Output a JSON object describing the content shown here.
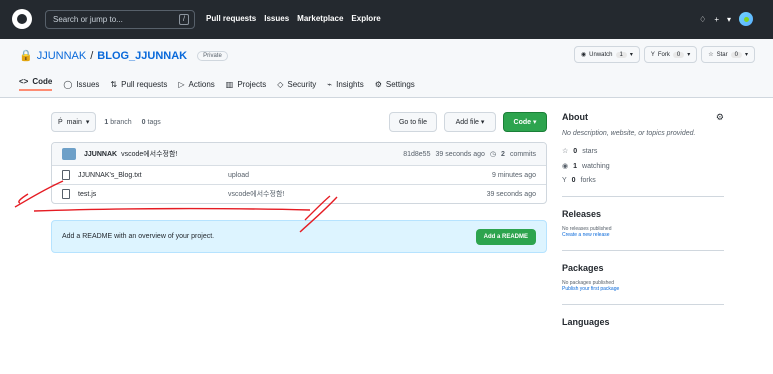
{
  "header": {
    "search_placeholder": "Search or jump to...",
    "slash_key": "/",
    "nav": [
      "Pull requests",
      "Issues",
      "Marketplace",
      "Explore"
    ],
    "plus": "+",
    "chevron": "▾"
  },
  "repo": {
    "owner": "JJUNNAK",
    "separator": "/",
    "name": "BLOG_JJUNNAK",
    "visibility": "Private",
    "unwatch": "Unwatch",
    "watch_count": "1",
    "fork": "Fork",
    "fork_count": "0",
    "star": "Star",
    "star_count": "0"
  },
  "tabs": [
    "Code",
    "Issues",
    "Pull requests",
    "Actions",
    "Projects",
    "Security",
    "Insights",
    "Settings"
  ],
  "toolbar": {
    "branch": "main",
    "branches": "1",
    "branches_label": "branch",
    "tags": "0",
    "tags_label": "tags",
    "go_to_file": "Go to file",
    "add_file": "Add file",
    "code": "Code"
  },
  "commit": {
    "author": "JJUNNAK",
    "message": "vscode에서수정함!",
    "hash": "81d8e55",
    "time": "39 seconds ago",
    "commits": "2",
    "commits_label": "commits"
  },
  "files": [
    {
      "name": "JJUNNAK's_Blog.txt",
      "message": "upload",
      "time": "9 minutes ago"
    },
    {
      "name": "test.js",
      "message": "vscode에서수정함!",
      "time": "39 seconds ago"
    }
  ],
  "readme": {
    "text": "Add a README with an overview of your project.",
    "button": "Add a README"
  },
  "about": {
    "title": "About",
    "description": "No description, website, or topics provided.",
    "stars": "0",
    "stars_label": "stars",
    "watching": "1",
    "watching_label": "watching",
    "forks": "0",
    "forks_label": "forks"
  },
  "releases": {
    "title": "Releases",
    "empty": "No releases published",
    "link": "Create a new release"
  },
  "packages": {
    "title": "Packages",
    "empty": "No packages published",
    "link": "Publish your first package"
  },
  "languages": {
    "title": "Languages"
  },
  "colors": {
    "annotation": "#e51c23"
  }
}
